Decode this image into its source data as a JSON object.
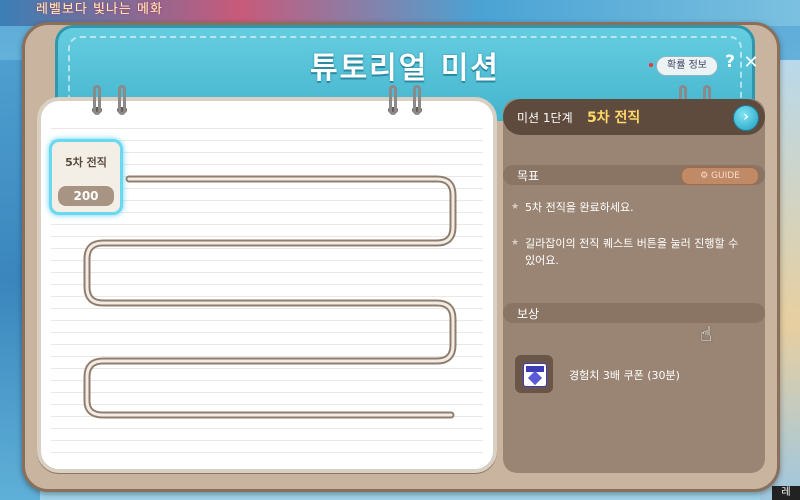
{
  "background": {
    "banner_text": "레벨보다 빛나는 메화",
    "corner_text": "레"
  },
  "window": {
    "title": "튜토리얼 미션",
    "probability_button": "확률 정보",
    "help_button": "?",
    "close_button": "✕"
  },
  "notebook": {
    "mission_card": {
      "title": "5차 전직",
      "score": "200"
    }
  },
  "panel": {
    "stage_label": "미션 1단계",
    "stage_name": "5차 전직",
    "go_icon": "›",
    "objective_label": "목표",
    "guide_button": "⚙ GUIDE",
    "objectives": [
      "5차 전직을 완료하세요.",
      "길라잡이의 전직 퀘스트 버튼을 눌러 진행할 수 있어요."
    ],
    "reward_label": "보상",
    "reward_item": "경험치 3배 쿠폰 (30분)"
  },
  "colors": {
    "header": "#4dbfd6",
    "panel": "#9a8574",
    "stage_highlight": "#ffd866",
    "card_glow": "#6ad8f0"
  }
}
